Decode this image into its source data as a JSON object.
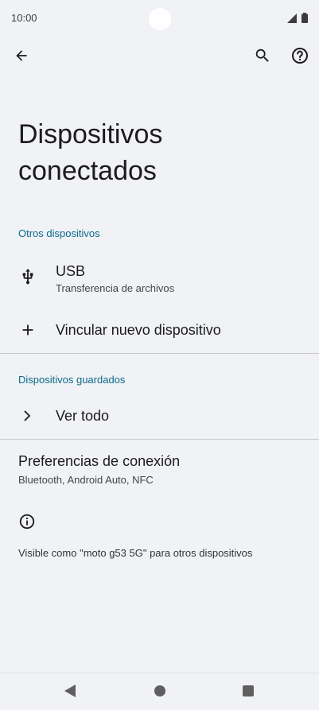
{
  "status_bar": {
    "time": "10:00"
  },
  "app_bar": {
    "back_icon": "arrow-back-icon",
    "search_icon": "search-icon",
    "help_icon": "help-icon"
  },
  "page": {
    "title": "Dispositivos conectados"
  },
  "sections": {
    "otros": {
      "header": "Otros dispositivos"
    },
    "guardados": {
      "header": "Dispositivos guardados"
    }
  },
  "usb": {
    "title": "USB",
    "subtitle": "Transferencia de archivos",
    "icon": "usb-icon"
  },
  "pair": {
    "label": "Vincular nuevo dispositivo",
    "icon": "plus-icon"
  },
  "see_all": {
    "label": "Ver todo",
    "icon": "chevron-right-icon"
  },
  "prefs": {
    "title": "Preferencias de conexión",
    "subtitle": "Bluetooth, Android Auto, NFC"
  },
  "info": {
    "icon": "info-icon",
    "text": "Visible como \"moto g53 5G\" para otros dispositivos"
  },
  "colors": {
    "background": "#f0f2f5",
    "accent": "#0a6a8a",
    "text": "#1c1b1f"
  }
}
